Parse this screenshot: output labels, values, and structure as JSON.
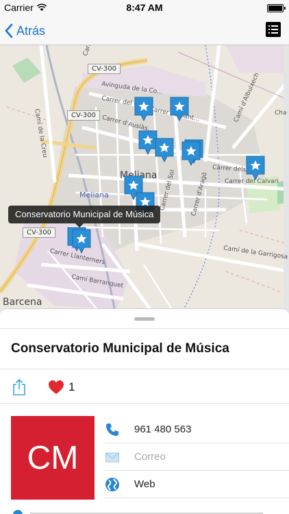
{
  "status_bar": {
    "carrier": "Carrier",
    "time": "8:47 AM"
  },
  "nav": {
    "back_label": "Atrás",
    "accent_color": "#1a72d2"
  },
  "map": {
    "road_badges": [
      "CV-300",
      "CV-300",
      "CV-300"
    ],
    "town_labels": [
      "Meliana",
      "Meliana",
      "Barcena"
    ],
    "street_labels": {
      "periodistas": "Carrer dels Periodistas",
      "creu": "Camí de la Creu",
      "avinguda": "Avinguda de la Co...",
      "cid": "Carrer del Cid",
      "sant": "Carrer de Sant...",
      "ausias": "Carrer d'Ausiàs...",
      "albuixech": "Camí d'Albuixech",
      "cha": "Cha",
      "dels_f": "Carrer dels F...",
      "calvari": "Carrer del Calvari",
      "arago": "Carrer d'Aragó",
      "sol": "Carrer del Sol",
      "garrigosa": "Camí de la Garrigosa",
      "llanterners": "Carrer Llanterners",
      "barranquet": "Camí Barranquet"
    },
    "callout_text": "Conservatorio Municipal de Música",
    "pin_color": "#2c8fd6"
  },
  "sheet": {
    "title": "Conservatorio Municipal de Música",
    "like_count": "1",
    "logo_text": "CM",
    "logo_color": "#d52031",
    "contacts": [
      {
        "icon": "phone-icon",
        "text": "961 480 563"
      },
      {
        "icon": "mail-icon",
        "text": "Correo"
      },
      {
        "icon": "globe-icon",
        "text": "Web"
      }
    ]
  }
}
